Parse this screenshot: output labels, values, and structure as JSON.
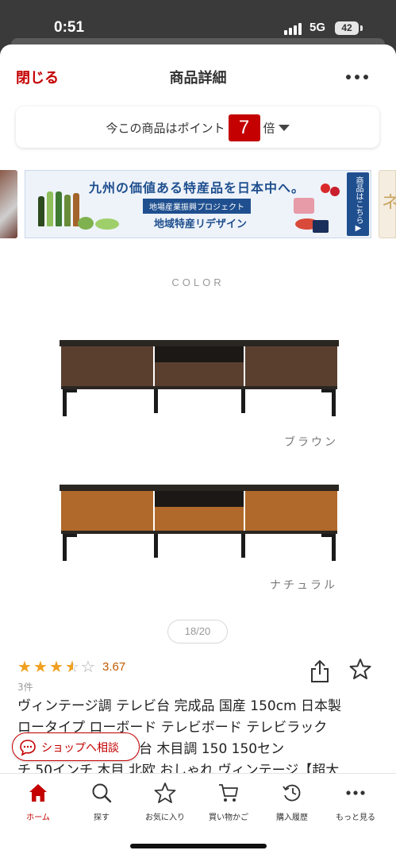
{
  "status_bar": {
    "time": "0:51",
    "network": "5G",
    "battery": "42"
  },
  "header": {
    "close_label": "閉じる",
    "title": "商品詳細",
    "more_icon": "more-dots-icon"
  },
  "points": {
    "text": "今この商品はポイント",
    "multiplier": "7",
    "suffix": "倍"
  },
  "banner": {
    "title": "九州の価値ある特産品を日本中へ。",
    "subtitle": "地場産業振興プロジェクト",
    "tagline": "地域特産リデザイン",
    "cta": "商品はこちら▶"
  },
  "color_section": {
    "heading": "COLOR",
    "variants": [
      {
        "caption": "ブラウン",
        "wood_color": "#5a3f2f"
      },
      {
        "caption": "ナチュラル",
        "wood_color": "#b0692a"
      }
    ]
  },
  "gallery": {
    "pager": "18/20"
  },
  "rating": {
    "value": "3.67",
    "stars": 3.67,
    "count": "3件"
  },
  "product_title": {
    "line1": "ヴィンテージ調 テレビ台 完成品 国産 150cm 日本製",
    "line2": "ロータイプ ローボード テレビボード テレビラック",
    "line3": "引き出し付きテレビ台 木目調 150 150セン",
    "line4": "チ 50インチ 木目 北欧 おしゃれ ヴィンテージ【超大"
  },
  "consult_button": {
    "label": "ショップへ相談"
  },
  "tabs": [
    {
      "label": "ホーム",
      "icon": "home-icon",
      "active": true
    },
    {
      "label": "探す",
      "icon": "search-icon",
      "active": false
    },
    {
      "label": "お気に入り",
      "icon": "star-icon",
      "active": false
    },
    {
      "label": "買い物かご",
      "icon": "cart-icon",
      "active": false
    },
    {
      "label": "購入履歴",
      "icon": "history-icon",
      "active": false
    },
    {
      "label": "もっと見る",
      "icon": "more-dots-icon",
      "active": false
    }
  ],
  "colors": {
    "brand_red": "#c40000",
    "rating_orange": "#c05a00",
    "star_gold": "#f0a020"
  }
}
